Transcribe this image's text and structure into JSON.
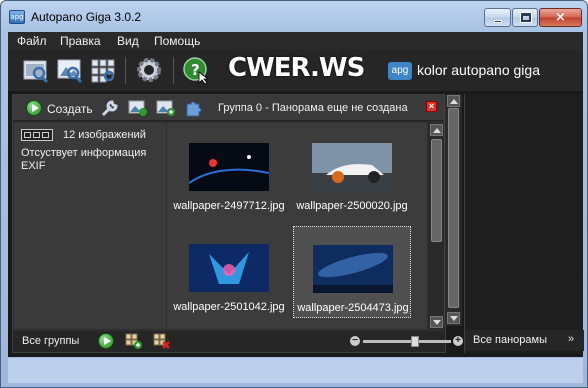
{
  "window": {
    "title": "Autopano Giga 3.0.2",
    "app_icon": "apg",
    "controls": {
      "minimize": "minimize-icon",
      "maximize": "maximize-icon",
      "close": "×"
    }
  },
  "menu": {
    "items": [
      {
        "label": "Файл"
      },
      {
        "label": "Правка"
      },
      {
        "label": "Вид"
      },
      {
        "label": "Помощь"
      }
    ]
  },
  "toolbar": {
    "icons": [
      "open-folder-icon",
      "import-images-icon",
      "detect-grid-icon",
      "settings-gear-icon",
      "help-icon"
    ],
    "watermark": "CWER.WS",
    "brand_badge": "apg",
    "brand": "kolor autopano giga"
  },
  "group": {
    "create_label": "Создать",
    "title": "Группа 0 - Панорама еще не создана",
    "close_glyph": "×",
    "image_count": "12 изображений",
    "exif_info": "Отсуствует информация EXIF",
    "images": [
      {
        "filename": "wallpaper-2497712.jpg",
        "selected": false
      },
      {
        "filename": "wallpaper-2500020.jpg",
        "selected": false
      },
      {
        "filename": "wallpaper-2501042.jpg",
        "selected": false
      },
      {
        "filename": "wallpaper-2504473.jpg",
        "selected": true
      }
    ],
    "footer_label": "Все группы",
    "zoom": {
      "minus": "−",
      "plus": "+",
      "level": 0.6
    }
  },
  "panoramas": {
    "footer_label": "Все панорамы",
    "expand": "»"
  },
  "colors": {
    "chrome": "#a9c3e4",
    "dark_bg": "#1a1a1a",
    "panel_bg": "#2f2f2f",
    "accent_green": "#1e8b1e",
    "close_red": "#c0402c"
  }
}
